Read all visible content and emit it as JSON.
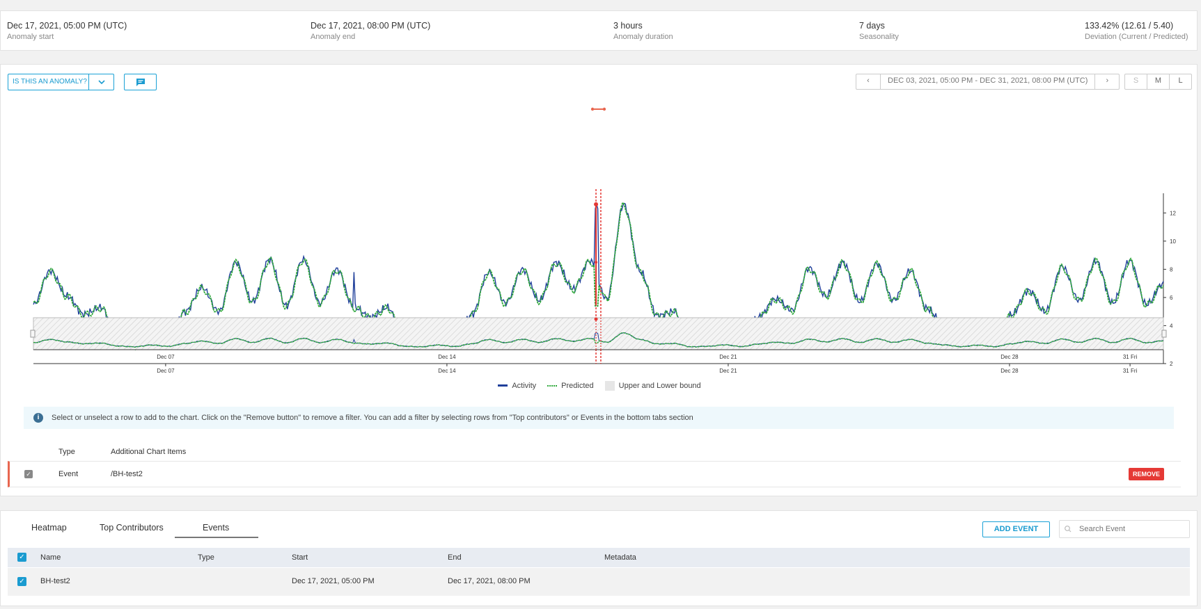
{
  "summary": [
    {
      "value": "Dec 17, 2021, 05:00 PM (UTC)",
      "label": "Anomaly start"
    },
    {
      "value": "Dec 17, 2021, 08:00 PM (UTC)",
      "label": "Anomaly end"
    },
    {
      "value": "3 hours",
      "label": "Anomaly duration"
    },
    {
      "value": "7 days",
      "label": "Seasonality"
    },
    {
      "value": "133.42% (12.61 / 5.40)",
      "label": "Deviation (Current / Predicted)"
    }
  ],
  "toolbar": {
    "anomaly_label": "IS THIS AN ANOMALY?",
    "range": "DEC 03, 2021, 05:00 PM - DEC 31, 2021, 08:00 PM (UTC)",
    "prev": "‹",
    "next": "›",
    "sizes": [
      "S",
      "M",
      "L"
    ]
  },
  "legend": [
    "Activity",
    "Predicted",
    "Upper and Lower bound"
  ],
  "colors": {
    "activity": "#1f3f9a",
    "predicted": "#2ea83a",
    "anomaly": "#e53935",
    "accent": "#1a9bd0"
  },
  "chart_data": {
    "type": "line",
    "x_tick_labels": [
      "Dec 07",
      "Dec 14",
      "Dec 21",
      "Dec 28",
      "31 Fri"
    ],
    "y_tick_labels": [
      "2",
      "4",
      "6",
      "8",
      "10",
      "12"
    ],
    "ylim": [
      2,
      13
    ],
    "x_range_days": [
      3.71,
      31.83
    ],
    "anomaly": {
      "start_day": 17.71,
      "end_day": 17.83,
      "current": 12.61,
      "predicted": 5.4
    },
    "series": [
      {
        "name": "Activity",
        "values_desc": "daily seasonal cycle, peak ~8-8.6, trough ~2.5-4"
      },
      {
        "name": "Predicted"
      }
    ],
    "activity_samples": [
      5.5,
      7.9,
      6.1,
      4.8,
      5.3,
      3.2,
      2.6,
      3.9,
      2.9,
      5.0,
      6.7,
      5.0,
      8.5,
      5.7,
      8.7,
      5.4,
      8.7,
      5.6,
      8.0,
      5.3,
      4.6,
      5.3,
      3.0,
      2.6,
      3.9,
      2.8,
      4.8,
      7.8,
      5.6,
      8.0,
      5.8,
      8.5,
      6.6,
      8.6,
      5.9,
      12.61,
      7.8,
      4.7,
      5.0,
      2.6,
      3.0,
      4.0,
      2.8,
      4.6,
      5.9,
      5.1,
      8.1,
      6.1,
      8.5,
      5.7,
      8.4,
      5.8,
      7.9,
      5.2,
      4.0,
      2.7,
      3.8,
      2.7,
      4.8,
      6.5,
      5.0,
      8.2,
      5.8,
      8.6,
      5.6,
      8.6,
      5.5,
      7.0
    ]
  },
  "info_text": "Select or unselect a row to add to the chart. Click on the \"Remove button\" to remove a filter. You can add a filter by selecting rows from \"Top contributors\" or Events in the bottom tabs section",
  "chart_items": {
    "headers": [
      "Type",
      "Additional Chart Items"
    ],
    "row": {
      "type": "Event",
      "item": "/BH-test2",
      "remove": "REMOVE"
    }
  },
  "tabs": [
    "Heatmap",
    "Top Contributors",
    "Events"
  ],
  "events": {
    "add_label": "ADD EVENT",
    "search_placeholder": "Search Event",
    "headers": [
      "Name",
      "Type",
      "Start",
      "End",
      "Metadata"
    ],
    "rows": [
      {
        "name": "BH-test2",
        "type": "",
        "start": "Dec 17, 2021, 05:00 PM",
        "end": "Dec 17, 2021, 08:00 PM",
        "metadata": ""
      }
    ]
  }
}
